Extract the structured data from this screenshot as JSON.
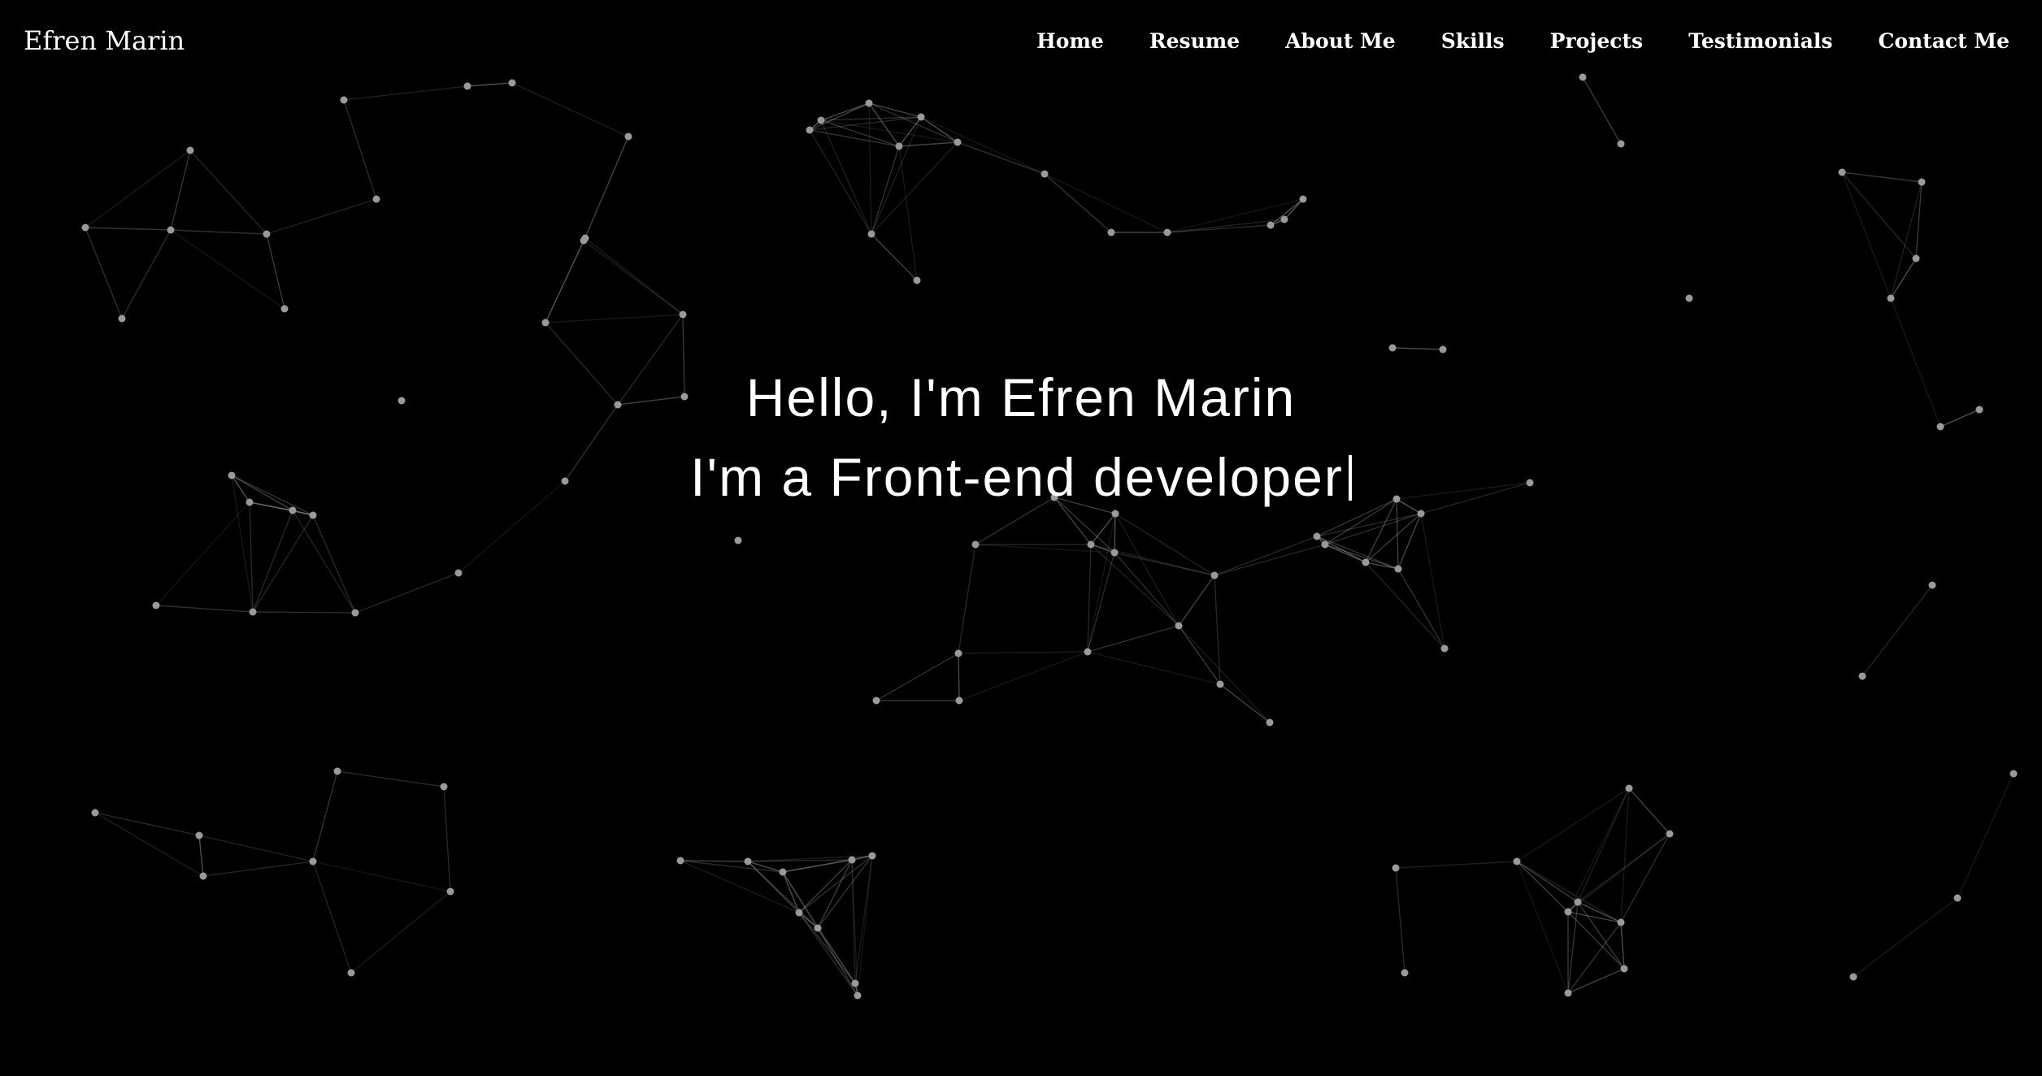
{
  "navbar": {
    "brand": "Efren Marin",
    "links": [
      {
        "label": "Home"
      },
      {
        "label": "Resume"
      },
      {
        "label": "About Me"
      },
      {
        "label": "Skills"
      },
      {
        "label": "Projects"
      },
      {
        "label": "Testimonials"
      },
      {
        "label": "Contact Me"
      }
    ]
  },
  "hero": {
    "greeting": "Hello, I'm Efren Marin",
    "role": "I'm a Front-end developer"
  },
  "theme": {
    "background": "#000000",
    "text": "#ffffff",
    "particle_color": "#9a9a9a"
  }
}
